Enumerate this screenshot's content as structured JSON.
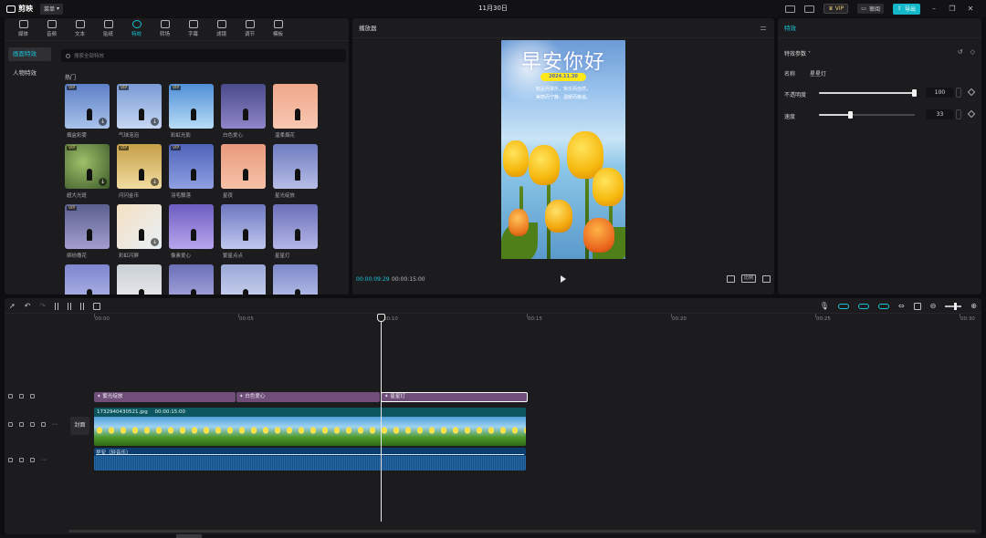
{
  "app": {
    "name": "剪映",
    "menu_label": "菜单",
    "title": "11月30日",
    "vip_label": "VIP",
    "review_label": "审阅",
    "export_label": "导出"
  },
  "media_tabs": [
    {
      "label": "媒体",
      "icon": "media-icon"
    },
    {
      "label": "音频",
      "icon": "audio-icon"
    },
    {
      "label": "文本",
      "icon": "text-icon"
    },
    {
      "label": "贴纸",
      "icon": "sticker-icon"
    },
    {
      "label": "特效",
      "icon": "effects-icon"
    },
    {
      "label": "转场",
      "icon": "transition-icon"
    },
    {
      "label": "字幕",
      "icon": "caption-icon"
    },
    {
      "label": "滤镜",
      "icon": "filter-icon"
    },
    {
      "label": "调节",
      "icon": "adjust-icon"
    },
    {
      "label": "模板",
      "icon": "template-icon"
    }
  ],
  "effects_nav": [
    "画面特效",
    "人物特效"
  ],
  "search_placeholder": "搜索全部特效",
  "section_title": "热门",
  "effects": [
    {
      "name": "烟盒彩雾",
      "vip": true,
      "download": true,
      "bg": "linear-gradient(180deg,#5d7fc8,#a9c3ea)"
    },
    {
      "name": "气球泡泡",
      "vip": true,
      "download": true,
      "bg": "linear-gradient(180deg,#7a9ad6,#c7d8f3)"
    },
    {
      "name": "彩虹光影",
      "vip": true,
      "download": false,
      "bg": "linear-gradient(180deg,#4f8fd8,#b8dcf6)"
    },
    {
      "name": "白色爱心",
      "vip": false,
      "download": false,
      "bg": "linear-gradient(180deg,#4a4a8a,#8e86c9)"
    },
    {
      "name": "温柔烟花",
      "vip": false,
      "download": false,
      "bg": "linear-gradient(180deg,#f0a78a,#f7c7b2)"
    },
    {
      "name": "超大光斑",
      "vip": true,
      "download": true,
      "bg": "radial-gradient(circle at 40% 40%,#9fc06a,#3c5a2a)"
    },
    {
      "name": "闪闪金币",
      "vip": true,
      "download": true,
      "bg": "linear-gradient(180deg,#c6a04a,#f1dca0)"
    },
    {
      "name": "羽毛飘落",
      "vip": true,
      "download": false,
      "bg": "linear-gradient(180deg,#4e63b8,#8fa0e2)"
    },
    {
      "name": "星夜",
      "vip": false,
      "download": false,
      "bg": "linear-gradient(180deg,#e99a7c,#f6c2a8)"
    },
    {
      "name": "星光绽放",
      "vip": false,
      "download": false,
      "bg": "linear-gradient(180deg,#6f7cc0,#b6bde6)"
    },
    {
      "name": "缤纷撒花",
      "vip": true,
      "download": false,
      "bg": "linear-gradient(180deg,#5a5f8e,#a39fd0)"
    },
    {
      "name": "彩虹闪屏",
      "vip": false,
      "download": true,
      "bg": "linear-gradient(135deg,#f5e0c2,#e6f0f6)"
    },
    {
      "name": "像素爱心",
      "vip": false,
      "download": false,
      "bg": "linear-gradient(180deg,#6b5dc0,#b9a6ee)"
    },
    {
      "name": "繁星点点",
      "vip": false,
      "download": false,
      "bg": "linear-gradient(180deg,#6d78c0,#c0c7ee)"
    },
    {
      "name": "星星灯",
      "vip": false,
      "download": false,
      "bg": "linear-gradient(180deg,#6a6fb8,#b4b6e8)"
    },
    {
      "name": "",
      "vip": false,
      "download": false,
      "bg": "linear-gradient(180deg,#7e86cf,#b9bde9)"
    },
    {
      "name": "",
      "vip": false,
      "download": false,
      "bg": "linear-gradient(180deg,#c9cfd6,#f0f0f0)"
    },
    {
      "name": "",
      "vip": false,
      "download": false,
      "bg": "linear-gradient(180deg,#6a6fb8,#b6b3e6)"
    },
    {
      "name": "",
      "vip": false,
      "download": false,
      "bg": "linear-gradient(180deg,#9aa8d8,#d7ddf3)"
    },
    {
      "name": "",
      "vip": false,
      "download": false,
      "bg": "linear-gradient(180deg,#7c88c8,#c6cdf0)"
    }
  ],
  "player": {
    "title": "播放器",
    "canvas_title": "早安你好",
    "canvas_date": "2024.11.30",
    "canvas_sub_1": "知足而常乐，常乐而自然，",
    "canvas_sub_2": "美丽而宁静，温暖而静谧。",
    "time_current": "00:00:09:29",
    "time_total": "00:00:15:00",
    "ratio_label": "比例"
  },
  "inspector": {
    "tab": "特效",
    "section": "特效参数",
    "name_label": "名称",
    "name_value": "星星灯",
    "opacity_label": "不透明度",
    "opacity_value": "100",
    "opacity_level": 1.0,
    "speed_label": "速度",
    "speed_value": "33",
    "speed_level": 0.33
  },
  "timeline": {
    "ticks": [
      "00:00",
      "00:05",
      "00:10",
      "00:15",
      "00:20",
      "00:25",
      "00:30"
    ],
    "effect_clips": [
      {
        "label": "繁光绽放",
        "selected": false
      },
      {
        "label": "白色爱心",
        "selected": false
      },
      {
        "label": "星星灯",
        "selected": true
      }
    ],
    "video_clip_name": "1732940430521.jpg",
    "video_clip_duration": "00:00:15:00",
    "audio_clip_name": "早安（轻音乐）",
    "cover_label": "封面"
  }
}
